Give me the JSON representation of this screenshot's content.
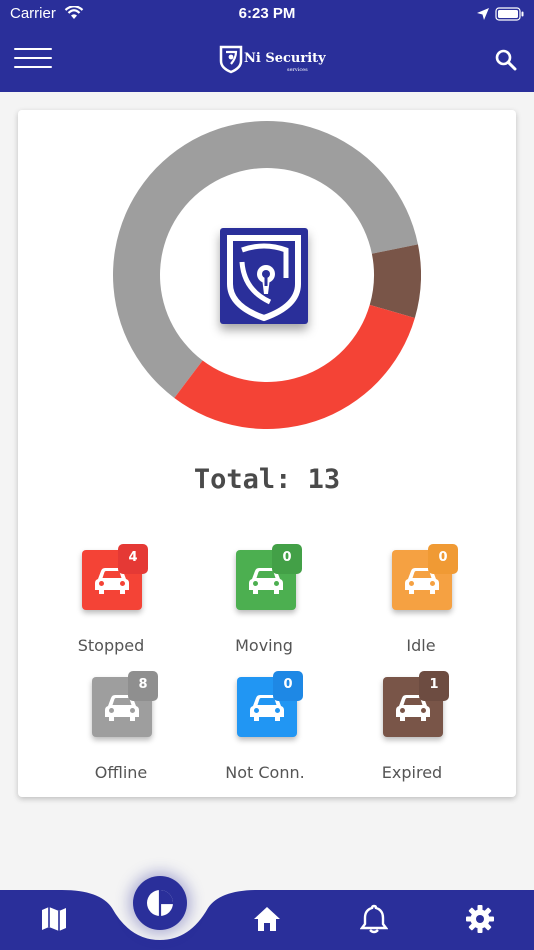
{
  "status_bar": {
    "carrier": "Carrier",
    "time": "6:23 PM"
  },
  "app_bar": {
    "logo_text": "Ni Security",
    "logo_subtext": "services"
  },
  "summary": {
    "total_label": "Total: 13"
  },
  "vehicle_status": [
    {
      "key": "stopped",
      "label": "Stopped",
      "count": "4",
      "color": "#f44336",
      "badge_color": "#e53935"
    },
    {
      "key": "moving",
      "label": "Moving",
      "count": "0",
      "color": "#4caf50",
      "badge_color": "#43a047"
    },
    {
      "key": "idle",
      "label": "Idle",
      "count": "0",
      "color": "#f5a142",
      "badge_color": "#f09a34"
    },
    {
      "key": "offline",
      "label": "Offline",
      "count": "8",
      "color": "#9e9e9e",
      "badge_color": "#8f8f8f"
    },
    {
      "key": "not-connected",
      "label": "Not Conn.",
      "count": "0",
      "color": "#2196f3",
      "badge_color": "#1e88e5"
    },
    {
      "key": "expired",
      "label": "Expired",
      "count": "1",
      "color": "#795548",
      "badge_color": "#6d4c41"
    }
  ],
  "chart_data": {
    "type": "pie",
    "variant": "donut",
    "segments": [
      {
        "label": "Offline",
        "value": 8,
        "color": "#9e9e9e"
      },
      {
        "label": "Expired",
        "value": 1,
        "color": "#795548"
      },
      {
        "label": "Stopped",
        "value": 4,
        "color": "#f44336"
      }
    ],
    "total": 13
  },
  "bottom_nav": {
    "items": [
      "map-icon",
      "dashboard-icon",
      "home-icon",
      "bell-icon",
      "gear-icon"
    ],
    "active": "dashboard-icon",
    "bar_color": "#2a2f9a"
  }
}
